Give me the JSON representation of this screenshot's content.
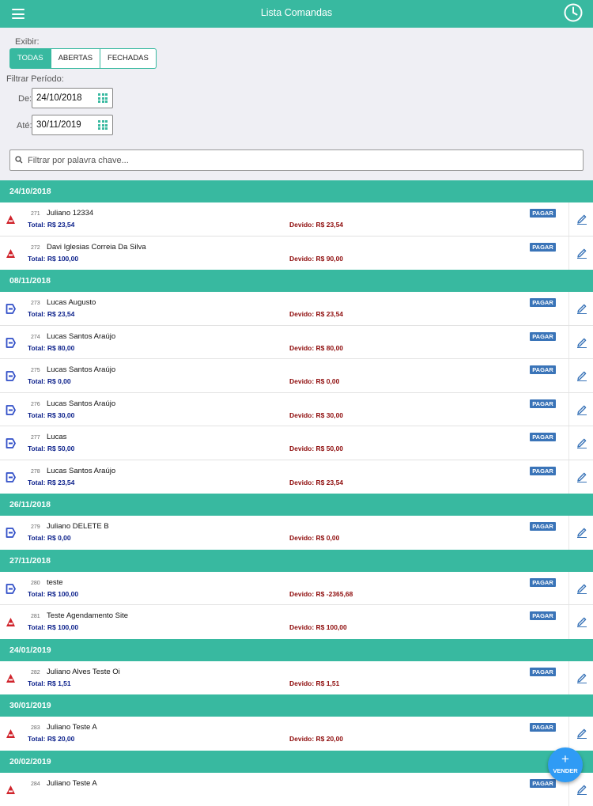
{
  "header": {
    "title": "Lista Comandas",
    "menu_icon": "hamburger-menu-icon",
    "clock_icon": "clock-icon"
  },
  "filters": {
    "show_label": "Exibir:",
    "segments": [
      {
        "label": "TODAS",
        "active": true
      },
      {
        "label": "ABERTAS",
        "active": false
      },
      {
        "label": "FECHADAS",
        "active": false
      }
    ],
    "period_label": "Filtrar Período:",
    "from_label": "De:",
    "from_value": "24/10/2018",
    "to_label": "Até:",
    "to_value": "30/11/2019",
    "search_placeholder": "Filtrar por palavra chave..."
  },
  "colors": {
    "accent": "#38b9a0",
    "total": "#0a1f8a",
    "devido": "#8e0b0b",
    "pay_badge": "#3a74b8",
    "fab": "#2f9bf5",
    "open_icon": "#2f4dc7",
    "closed_icon": "#d0232b"
  },
  "groups": [
    {
      "date": "24/10/2018",
      "items": [
        {
          "num": "271",
          "name": "Juliano 12334",
          "total": "Total: R$ 23,54",
          "devido": "Devido: R$ 23,54",
          "status": "closed",
          "pay": "PAGAR"
        },
        {
          "num": "272",
          "name": "Davi Iglesias Correia Da Silva",
          "total": "Total: R$ 100,00",
          "devido": "Devido: R$ 90,00",
          "status": "closed",
          "pay": "PAGAR"
        }
      ]
    },
    {
      "date": "08/11/2018",
      "items": [
        {
          "num": "273",
          "name": "Lucas Augusto",
          "total": "Total: R$ 23,54",
          "devido": "Devido: R$ 23,54",
          "status": "open",
          "pay": "PAGAR"
        },
        {
          "num": "274",
          "name": "Lucas Santos Araújo",
          "total": "Total: R$ 80,00",
          "devido": "Devido: R$ 80,00",
          "status": "open",
          "pay": "PAGAR"
        },
        {
          "num": "275",
          "name": "Lucas Santos Araújo",
          "total": "Total: R$ 0,00",
          "devido": "Devido: R$ 0,00",
          "status": "open",
          "pay": "PAGAR"
        },
        {
          "num": "276",
          "name": "Lucas Santos Araújo",
          "total": "Total: R$ 30,00",
          "devido": "Devido: R$ 30,00",
          "status": "open",
          "pay": "PAGAR"
        },
        {
          "num": "277",
          "name": "Lucas",
          "total": "Total: R$ 50,00",
          "devido": "Devido: R$ 50,00",
          "status": "open",
          "pay": "PAGAR"
        },
        {
          "num": "278",
          "name": "Lucas Santos Araújo",
          "total": "Total: R$ 23,54",
          "devido": "Devido: R$ 23,54",
          "status": "open",
          "pay": "PAGAR"
        }
      ]
    },
    {
      "date": "26/11/2018",
      "items": [
        {
          "num": "279",
          "name": "Juliano DELETE B",
          "total": "Total: R$ 0,00",
          "devido": "Devido: R$ 0,00",
          "status": "open",
          "pay": "PAGAR"
        }
      ]
    },
    {
      "date": "27/11/2018",
      "items": [
        {
          "num": "280",
          "name": "teste",
          "total": "Total: R$ 100,00",
          "devido": "Devido: R$ -2365,68",
          "status": "open",
          "pay": "PAGAR"
        },
        {
          "num": "281",
          "name": "Teste Agendamento Site",
          "total": "Total: R$ 100,00",
          "devido": "Devido: R$ 100,00",
          "status": "closed",
          "pay": "PAGAR"
        }
      ]
    },
    {
      "date": "24/01/2019",
      "items": [
        {
          "num": "282",
          "name": "Juliano Alves Teste Oi",
          "total": "Total: R$ 1,51",
          "devido": "Devido: R$ 1,51",
          "status": "closed",
          "pay": "PAGAR"
        }
      ]
    },
    {
      "date": "30/01/2019",
      "items": [
        {
          "num": "283",
          "name": "Juliano Teste A",
          "total": "Total: R$ 20,00",
          "devido": "Devido: R$ 20,00",
          "status": "closed",
          "pay": "PAGAR"
        }
      ]
    },
    {
      "date": "20/02/2019",
      "items": [
        {
          "num": "284",
          "name": "Juliano Teste A",
          "total": "",
          "devido": "",
          "status": "closed",
          "pay": "PAGAR"
        }
      ]
    }
  ],
  "fab": {
    "symbol": "+",
    "label": "VENDER"
  }
}
